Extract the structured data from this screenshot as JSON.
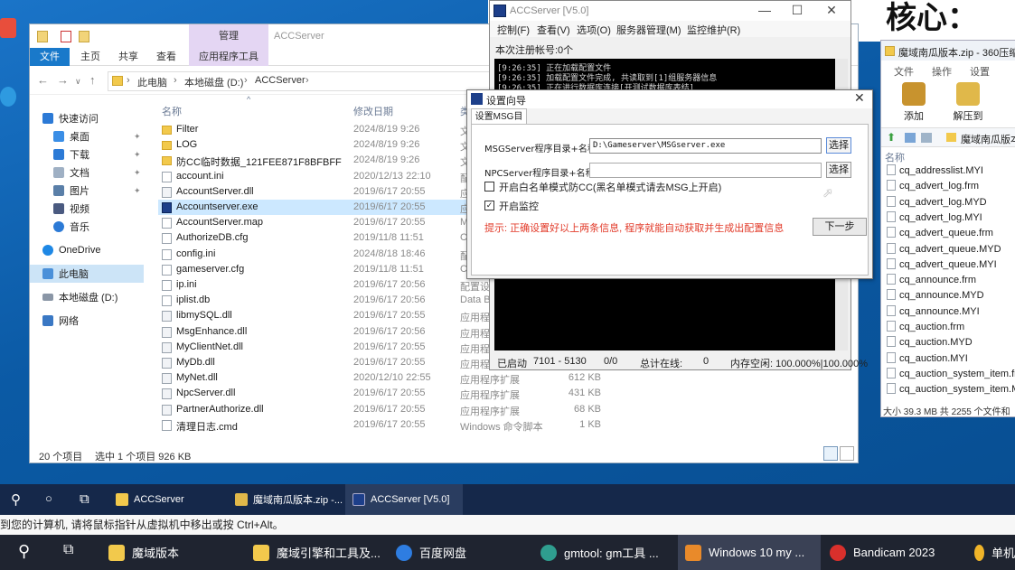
{
  "top_banner": "核心：",
  "explorer": {
    "title": "ACCServer",
    "manage_tab": "管理",
    "ribbon_tabs": [
      "文件",
      "主页",
      "共享",
      "查看"
    ],
    "app_tools_tab": "应用程序工具",
    "breadcrumb": [
      "此电脑",
      "本地磁盘 (D:)",
      "ACCServer"
    ],
    "nav": {
      "quick_access": "快速访问",
      "desktop": "桌面",
      "downloads": "下载",
      "documents": "文档",
      "pictures": "图片",
      "videos": "视频",
      "music": "音乐",
      "onedrive": "OneDrive",
      "this_pc": "此电脑",
      "local_disk": "本地磁盘 (D:)",
      "network": "网络"
    },
    "columns": {
      "name": "名称",
      "date": "修改日期",
      "type": "类"
    },
    "files": [
      {
        "name": "Filter",
        "date": "2024/8/19 9:26",
        "type": "文",
        "size": "",
        "icon": "folder"
      },
      {
        "name": "LOG",
        "date": "2024/8/19 9:26",
        "type": "文",
        "size": "",
        "icon": "folder"
      },
      {
        "name": "防CC临时数据_121FEE871F8BFBFF",
        "date": "2024/8/19 9:26",
        "type": "文",
        "size": "",
        "icon": "folder"
      },
      {
        "name": "account.ini",
        "date": "2020/12/13 22:10",
        "type": "配",
        "size": "",
        "icon": "doc"
      },
      {
        "name": "AccountServer.dll",
        "date": "2019/6/17 20:55",
        "type": "应",
        "size": "",
        "icon": "dll"
      },
      {
        "name": "Accountserver.exe",
        "date": "2019/6/17 20:55",
        "type": "应",
        "size": "",
        "icon": "exe"
      },
      {
        "name": "AccountServer.map",
        "date": "2019/6/17 20:55",
        "type": "M",
        "size": "",
        "icon": "doc"
      },
      {
        "name": "AuthorizeDB.cfg",
        "date": "2019/11/8 11:51",
        "type": "CF",
        "size": "",
        "icon": "doc"
      },
      {
        "name": "config.ini",
        "date": "2024/8/18 18:46",
        "type": "配",
        "size": "",
        "icon": "doc"
      },
      {
        "name": "gameserver.cfg",
        "date": "2019/11/8 11:51",
        "type": "CF",
        "size": "",
        "icon": "doc"
      },
      {
        "name": "ip.ini",
        "date": "2019/6/17 20:56",
        "type": "配置设",
        "size": "",
        "icon": "doc"
      },
      {
        "name": "iplist.db",
        "date": "2019/6/17 20:56",
        "type": "Data Ba",
        "size": "",
        "icon": "doc"
      },
      {
        "name": "libmySQL.dll",
        "date": "2019/6/17 20:55",
        "type": "应用程序",
        "size": "",
        "icon": "dll"
      },
      {
        "name": "MsgEnhance.dll",
        "date": "2019/6/17 20:56",
        "type": "应用程序",
        "size": "",
        "icon": "dll"
      },
      {
        "name": "MyClientNet.dll",
        "date": "2019/6/17 20:55",
        "type": "应用程序",
        "size": "",
        "icon": "dll"
      },
      {
        "name": "MyDb.dll",
        "date": "2019/6/17 20:55",
        "type": "应用程序",
        "size": "",
        "icon": "dll"
      },
      {
        "name": "MyNet.dll",
        "date": "2020/12/10 22:55",
        "type": "应用程序扩展",
        "size": "612 KB",
        "icon": "dll"
      },
      {
        "name": "NpcServer.dll",
        "date": "2019/6/17 20:55",
        "type": "应用程序扩展",
        "size": "431 KB",
        "icon": "dll"
      },
      {
        "name": "PartnerAuthorize.dll",
        "date": "2019/6/17 20:55",
        "type": "应用程序扩展",
        "size": "68 KB",
        "icon": "dll"
      },
      {
        "name": "清理日志.cmd",
        "date": "2019/6/17 20:55",
        "type": "Windows 命令脚本",
        "size": "1 KB",
        "icon": "doc"
      }
    ],
    "status": {
      "count": "20 个项目",
      "selected": "选中 1 个项目  926 KB"
    }
  },
  "acc": {
    "title": "ACCServer [V5.0]",
    "menu": [
      "控制(F)",
      "查看(V)",
      "选项(O)",
      "服务器管理(M)",
      "监控维护(R)"
    ],
    "account_label": "本次注册帐号:0个",
    "log_lines": [
      "[9:26:35] 正在加载配置文件",
      "[9:26:35] 加载配置文件完成, 共读取到[1]组服务器信息",
      "[9:26:35] 正在进行数据库连接[开测试数据库表结]"
    ],
    "status": {
      "state": "已启动",
      "ports": "7101 - 5130",
      "ratio": "0/0",
      "online_label": "总计在线:",
      "online": "0",
      "memory": "内存空闲: 100.000%|100.000%"
    }
  },
  "wizard": {
    "title": "设置向导",
    "tab": "设置MSG目录",
    "msg_label": "MSGServer程序目录+名称:",
    "msg_value": "D:\\Gameserver\\MSGserver.exe",
    "npc_label": "NPCServer程序目录+名称:",
    "npc_value": "",
    "browse": "选择",
    "whitelist_label": "开启白名单模式防CC(黑名单模式请去MSG上开启)",
    "monitor_label": "开启监控",
    "tip": "提示: 正确设置好以上两条信息, 程序就能自动获取并生成出配置信息",
    "next": "下一步"
  },
  "zip": {
    "title": "魔域南瓜版本.zip - 360压缩",
    "menu": [
      "文件",
      "操作",
      "设置"
    ],
    "add": "添加",
    "extract": "解压到",
    "path": "魔域南瓜版本",
    "column": "名称",
    "entries": [
      "cq_addresslist.MYI",
      "cq_advert_log.frm",
      "cq_advert_log.MYD",
      "cq_advert_log.MYI",
      "cq_advert_queue.frm",
      "cq_advert_queue.MYD",
      "cq_advert_queue.MYI",
      "cq_announce.frm",
      "cq_announce.MYD",
      "cq_announce.MYI",
      "cq_auction.frm",
      "cq_auction.MYD",
      "cq_auction.MYI",
      "cq_auction_system_item.frm",
      "cq_auction_system_item.MYD"
    ],
    "status": "大小 39.3 MB 共 2255 个文件和"
  },
  "vm_taskbar": {
    "apps": [
      "ACCServer",
      "魔域南瓜版本.zip -...",
      "ACCServer [V5.0]"
    ]
  },
  "vm_hint": "到您的计算机, 请将鼠标指针从虚拟机中移出或按 Ctrl+Alt。",
  "host_taskbar": {
    "apps": [
      "魔域版本",
      "魔域引擎和工具及...",
      "百度网盘",
      "gmtool: gm工具 ...",
      "Windows 10 my ...",
      "Bandicam 2023",
      "单机"
    ]
  }
}
